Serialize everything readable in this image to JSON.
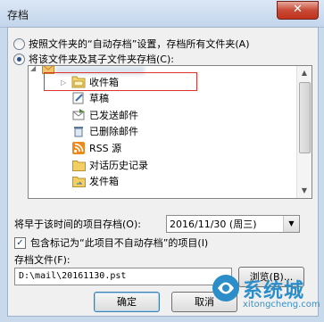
{
  "window": {
    "title": "存档",
    "close_label": "✕"
  },
  "options": {
    "radio_default": "按照文件夹的“自动存档”设置，存档所有文件夹(A)",
    "radio_custom": "将该文件夹及其子文件夹存档(C):"
  },
  "folders": [
    {
      "label": "收件箱",
      "icon": "inbox-icon"
    },
    {
      "label": "草稿",
      "icon": "drafts-icon"
    },
    {
      "label": "已发送邮件",
      "icon": "sent-icon"
    },
    {
      "label": "已删除邮件",
      "icon": "deleted-icon"
    },
    {
      "label": "RSS 源",
      "icon": "rss-icon"
    },
    {
      "label": "对话历史记录",
      "icon": "folder-icon"
    },
    {
      "label": "发件箱",
      "icon": "outbox-icon"
    }
  ],
  "archive_before": {
    "label": "将早于该时间的项目存档(O):",
    "value": "2016/11/30 (周三)"
  },
  "include_items_label": "包含标记为“此项目不自动存档”的项目(I)",
  "archive_file": {
    "label": "存档文件(F):",
    "value": "D:\\mail\\20161130.pst",
    "browse_label": "浏览(B)..."
  },
  "buttons": {
    "ok": "确定",
    "cancel": "取消"
  },
  "watermark": {
    "brand": "系统城",
    "site": "xitongcheng.com"
  }
}
